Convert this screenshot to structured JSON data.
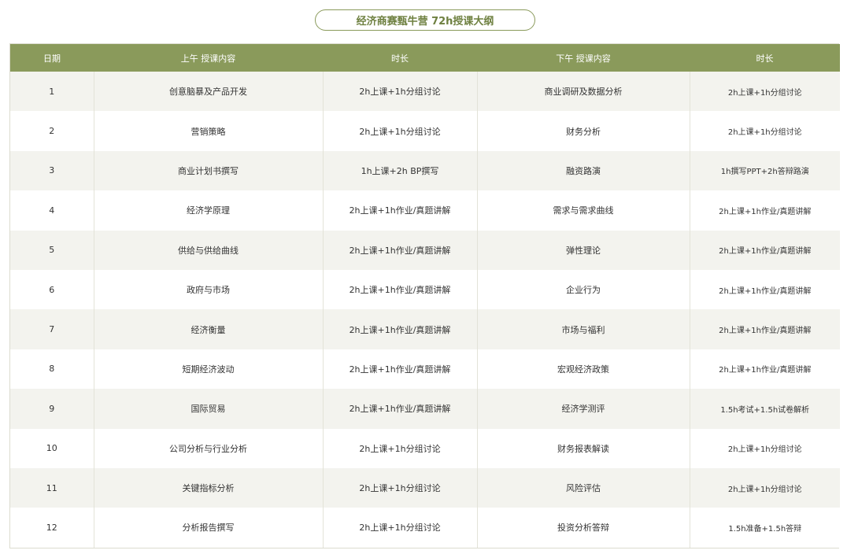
{
  "title": "经济商赛甄牛营 72h授课大纲",
  "accent_color": "#8a9a5b",
  "headers": [
    "日期",
    "上午 授课内容",
    "时长",
    "下午 授课内容",
    "时长"
  ],
  "rows": [
    [
      "1",
      "创意脑暴及产品开发",
      "2h上课+1h分组讨论",
      "商业调研及数据分析",
      "2h上课+1h分组讨论"
    ],
    [
      "2",
      "营销策略",
      "2h上课+1h分组讨论",
      "财务分析",
      "2h上课+1h分组讨论"
    ],
    [
      "3",
      "商业计划书撰写",
      "1h上课+2h BP撰写",
      "融资路演",
      "1h撰写PPT+2h答辩路演"
    ],
    [
      "4",
      "经济学原理",
      "2h上课+1h作业/真题讲解",
      "需求与需求曲线",
      "2h上课+1h作业/真题讲解"
    ],
    [
      "5",
      "供给与供给曲线",
      "2h上课+1h作业/真题讲解",
      "弹性理论",
      "2h上课+1h作业/真题讲解"
    ],
    [
      "6",
      "政府与市场",
      "2h上课+1h作业/真题讲解",
      "企业行为",
      "2h上课+1h作业/真题讲解"
    ],
    [
      "7",
      "经济衡量",
      "2h上课+1h作业/真题讲解",
      "市场与福利",
      "2h上课+1h作业/真题讲解"
    ],
    [
      "8",
      "短期经济波动",
      "2h上课+1h作业/真题讲解",
      "宏观经济政策",
      "2h上课+1h作业/真题讲解"
    ],
    [
      "9",
      "国际贸易",
      "2h上课+1h作业/真题讲解",
      "经济学测评",
      "1.5h考试+1.5h试卷解析"
    ],
    [
      "10",
      "公司分析与行业分析",
      "2h上课+1h分组讨论",
      "财务报表解读",
      "2h上课+1h分组讨论"
    ],
    [
      "11",
      "关键指标分析",
      "2h上课+1h分组讨论",
      "风险评估",
      "2h上课+1h分组讨论"
    ],
    [
      "12",
      "分析报告撰写",
      "2h上课+1h分组讨论",
      "投资分析答辩",
      "1.5h准备+1.5h答辩"
    ]
  ]
}
